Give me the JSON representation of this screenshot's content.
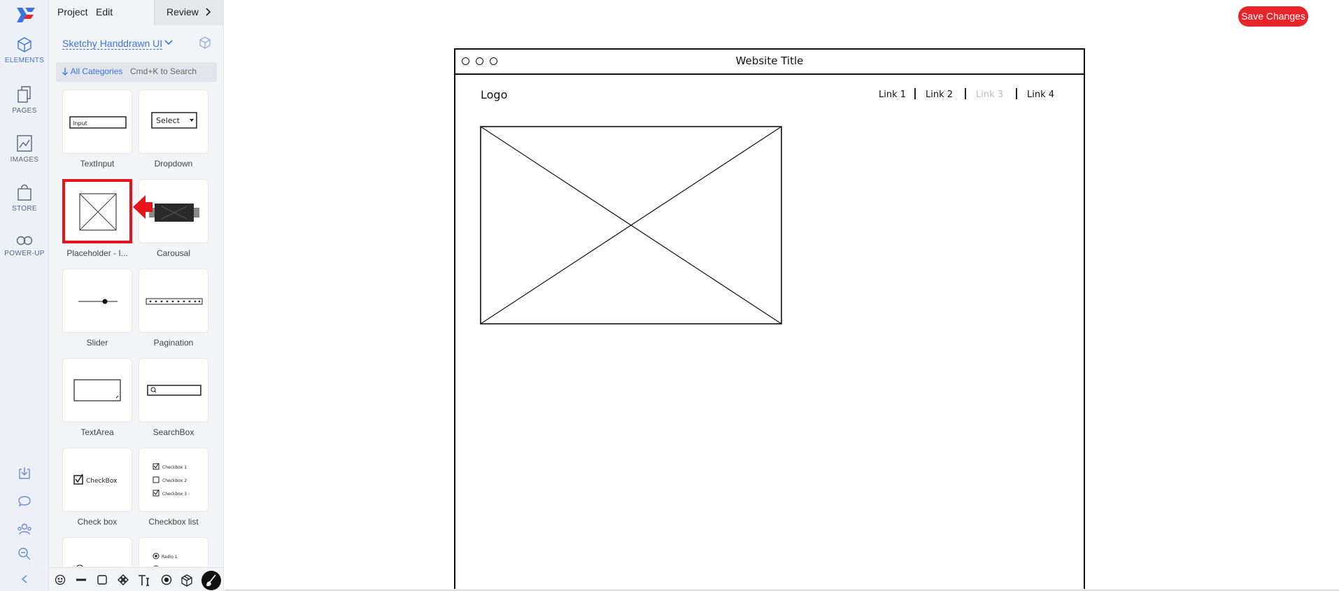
{
  "app": {
    "menu": {
      "project": "Project",
      "edit": "Edit",
      "review": "Review"
    },
    "save_button": "Save Changes",
    "colors": {
      "accent": "#3b73e6",
      "danger": "#e8242b",
      "rail_bg": "#eef0f7",
      "panel_bg": "#f3f4f7"
    }
  },
  "rail": {
    "items": [
      {
        "label": "ELEMENTS",
        "icon": "cube-icon",
        "active": true
      },
      {
        "label": "PAGES",
        "icon": "pages-icon",
        "active": false
      },
      {
        "label": "IMAGES",
        "icon": "images-icon",
        "active": false
      },
      {
        "label": "STORE",
        "icon": "shopping-bag-icon",
        "active": false
      },
      {
        "label": "POWER-UP",
        "icon": "infinity-icon",
        "active": false
      }
    ],
    "bottom_icons": [
      "download-icon",
      "comment-icon",
      "users-icon",
      "zoom-icon",
      "collapse-icon"
    ]
  },
  "panel": {
    "library": "Sketchy Handdrawn UI",
    "category_button": "All Categories",
    "search_hint": "Cmd+K to Search",
    "elements": [
      {
        "label": "TextInput",
        "preview_text": "Input"
      },
      {
        "label": "Dropdown",
        "preview_text": "Select"
      },
      {
        "label": "Placeholder - I...",
        "highlighted": true
      },
      {
        "label": "Carousal"
      },
      {
        "label": "Slider"
      },
      {
        "label": "Pagination"
      },
      {
        "label": "TextArea"
      },
      {
        "label": "SearchBox"
      },
      {
        "label": "Check box",
        "preview_text": "CheckBox"
      },
      {
        "label": "Checkbox list",
        "preview_items": [
          "Checkbox 1",
          "Checkbox 2",
          "Checkbox 3"
        ]
      },
      {
        "label": "",
        "partial": true
      },
      {
        "label": "",
        "partial": true,
        "preview_items": [
          "Radio 1"
        ]
      }
    ],
    "toolbar_icons": [
      "emoji-icon",
      "line-icon",
      "rectangle-icon",
      "move-icon",
      "text-icon",
      "target-icon",
      "box-icon",
      "brush-icon"
    ]
  },
  "wireframe": {
    "title": "Website Title",
    "logo": "Logo",
    "links": [
      {
        "label": "Link 1",
        "disabled": false
      },
      {
        "label": "Link 2",
        "disabled": false
      },
      {
        "label": "Link 3",
        "disabled": true
      },
      {
        "label": "Link 4",
        "disabled": false
      }
    ]
  }
}
